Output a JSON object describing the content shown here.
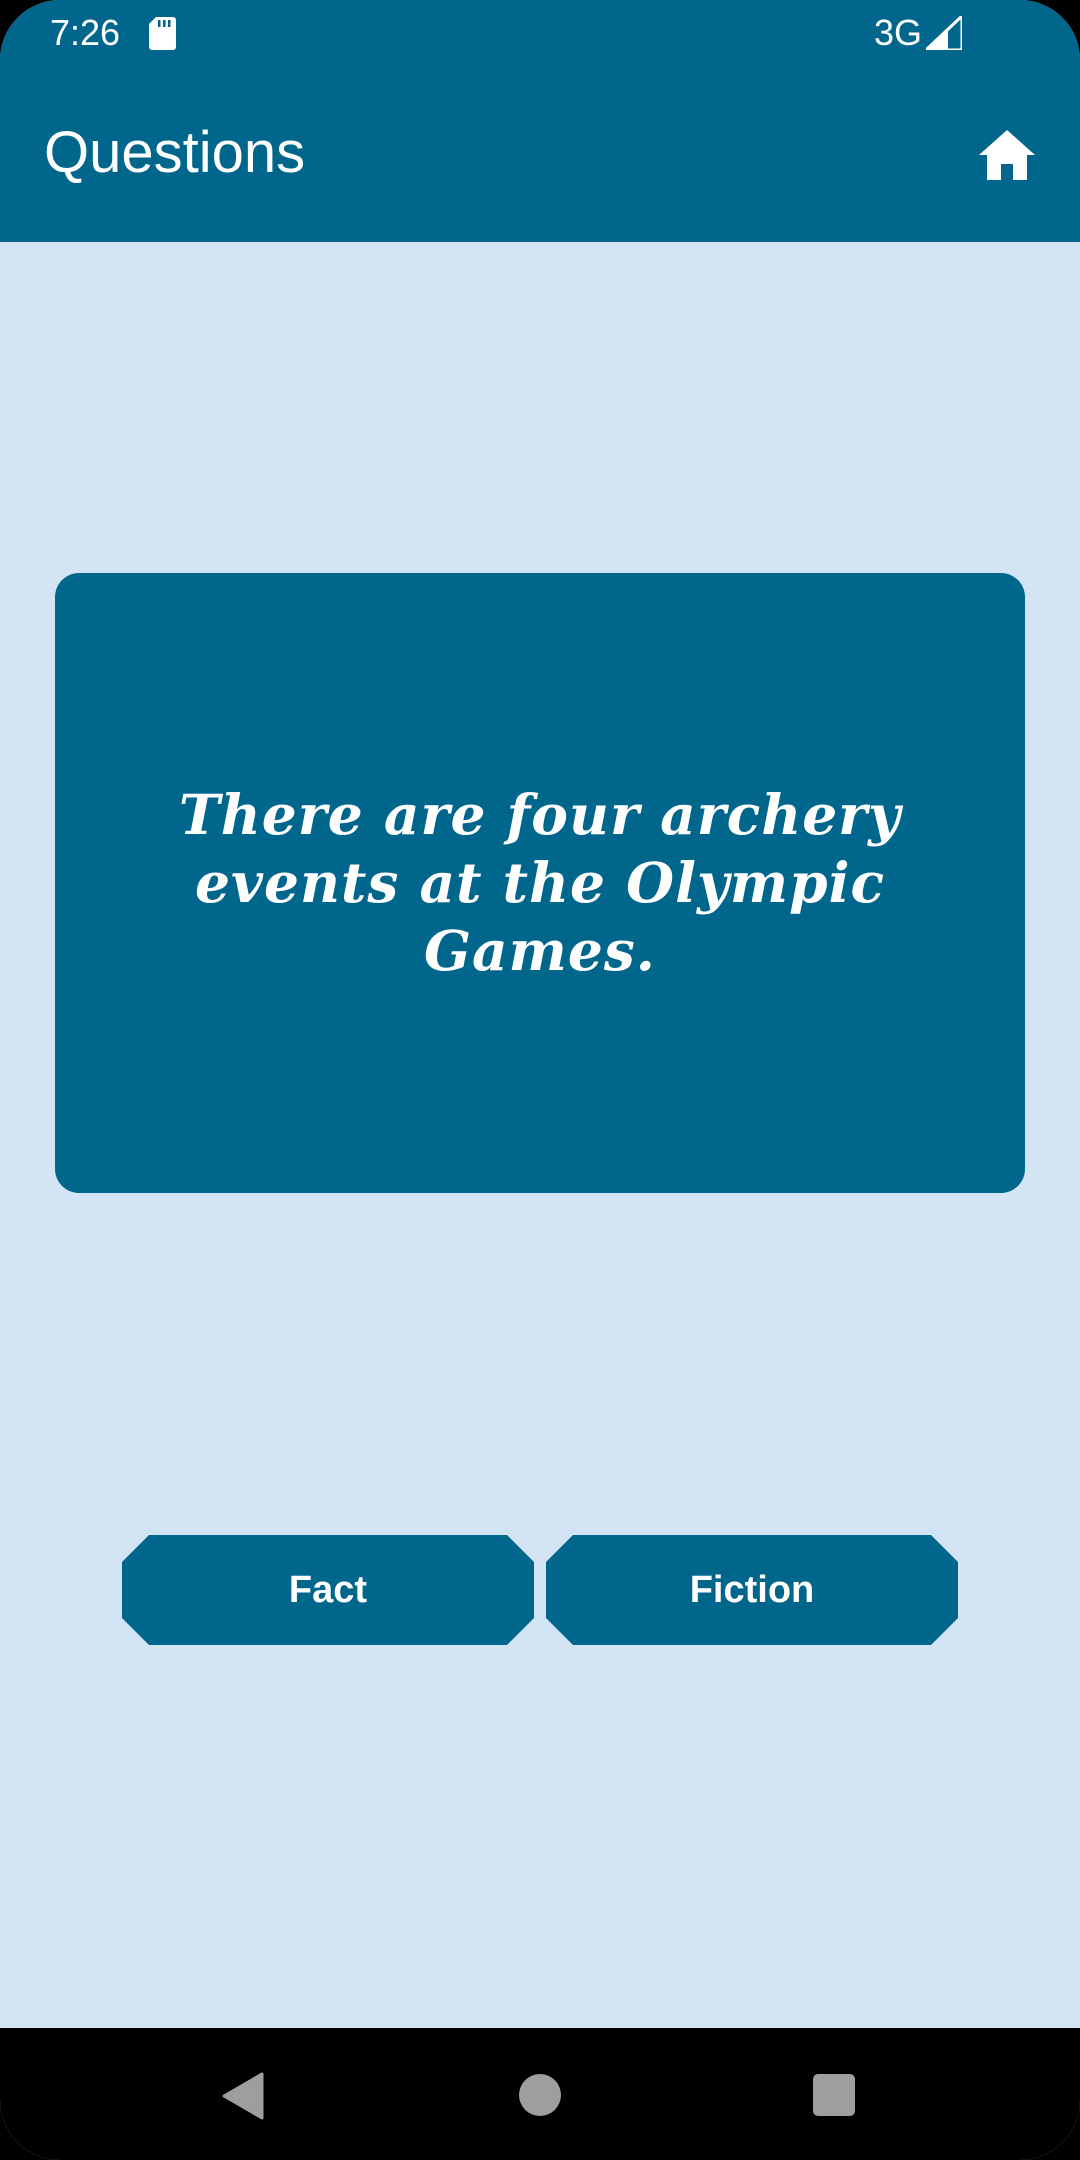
{
  "status_bar": {
    "time": "7:26",
    "network": "3G",
    "icons": [
      "sd-card-icon",
      "signal-icon"
    ]
  },
  "app_bar": {
    "title": "Questions",
    "home_icon": "home-icon"
  },
  "question": {
    "text": "There are four archery events at the Olympic Games."
  },
  "answers": {
    "fact_label": "Fact",
    "fiction_label": "Fiction"
  },
  "nav_bar": {
    "icons": [
      "back-icon",
      "home-circle-icon",
      "recents-icon"
    ]
  },
  "colors": {
    "primary": "#00668c",
    "background": "#d3e5f4",
    "on_primary": "#ffffff",
    "nav_bar": "#000000",
    "nav_icon": "#9e9e9e"
  }
}
